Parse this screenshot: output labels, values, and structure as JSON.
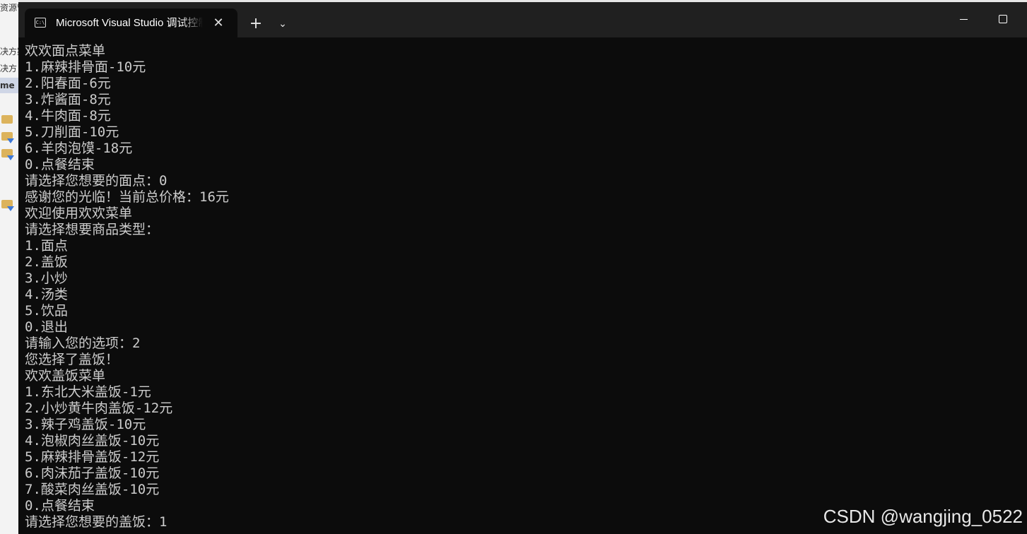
{
  "background_window": {
    "rows": [
      "资源管",
      "",
      "决方案",
      "决方",
      "me",
      "",
      "",
      "",
      "",
      "",
      "",
      ""
    ]
  },
  "window": {
    "tab_title": "Microsoft Visual Studio 调试控制台",
    "tab_icon_label": "C:\\",
    "close_tab_symbol": "✕",
    "new_tab_symbol": "+",
    "dropdown_symbol": "⌄"
  },
  "console": {
    "lines": [
      "欢欢面点菜单",
      "1.麻辣排骨面-10元",
      "2.阳春面-6元",
      "3.炸酱面-8元",
      "4.牛肉面-8元",
      "5.刀削面-10元",
      "6.羊肉泡馍-18元",
      "0.点餐结束",
      "请选择您想要的面点：0",
      "感谢您的光临！当前总价格：16元",
      "欢迎使用欢欢菜单",
      "请选择想要商品类型：",
      "1.面点",
      "2.盖饭",
      "3.小炒",
      "4.汤类",
      "5.饮品",
      "0.退出",
      "请输入您的选项：2",
      "您选择了盖饭！",
      "欢欢盖饭菜单",
      "1.东北大米盖饭-1元",
      "2.小炒黄牛肉盖饭-12元",
      "3.辣子鸡盖饭-10元",
      "4.泡椒肉丝盖饭-10元",
      "5.麻辣排骨盖饭-12元",
      "6.肉沫茄子盖饭-10元",
      "7.酸菜肉丝盖饭-10元",
      "0.点餐结束",
      "请选择您想要的盖饭：1"
    ]
  },
  "watermark": "CSDN @wangjing_0522",
  "colors": {
    "terminal_background": "#0c0c0c",
    "titlebar_background": "#202020",
    "console_text": "#cccccc"
  }
}
